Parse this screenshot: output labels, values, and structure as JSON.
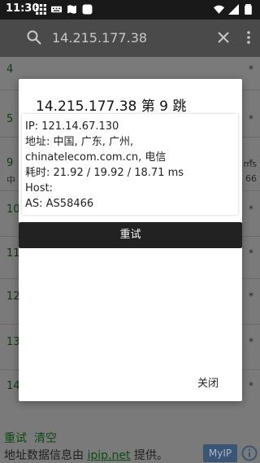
{
  "statusbar": {
    "time": "11:30"
  },
  "appbar": {
    "query": "14.215.177.38"
  },
  "list": {
    "rows": [
      {
        "hop": "4",
        "star": "*"
      },
      {
        "hop": "5",
        "star": "*"
      },
      {
        "hop": "9",
        "star": "*",
        "side_left": "中",
        "side_right_1": "ms",
        "side_right_2": "66"
      },
      {
        "hop": "10",
        "star": "*"
      },
      {
        "hop": "11",
        "star": "*"
      },
      {
        "hop": "12",
        "star": "*"
      },
      {
        "hop": "13",
        "star": "*"
      },
      {
        "hop": "14",
        "star": "*"
      }
    ]
  },
  "footer": {
    "retry_label": "重试",
    "clear_label": "清空",
    "source_prefix": "地址数据信息由 ",
    "source_link": "ipip.net",
    "source_suffix": " 提供。",
    "myip_label": "MyIP"
  },
  "dialog": {
    "title": "14.215.177.38 第 9 跳",
    "ip_line": "IP: 121.14.67.130",
    "address_line1": "地址: 中国, 广东, 广州,",
    "address_line2": "chinatelecom.com.cn, 电信",
    "latency_line": "耗时: 21.92 / 19.92 / 18.71 ms",
    "host_line": "Host:",
    "as_line": "AS: AS58466",
    "retry_button": "重试",
    "close_button": "关闭"
  }
}
